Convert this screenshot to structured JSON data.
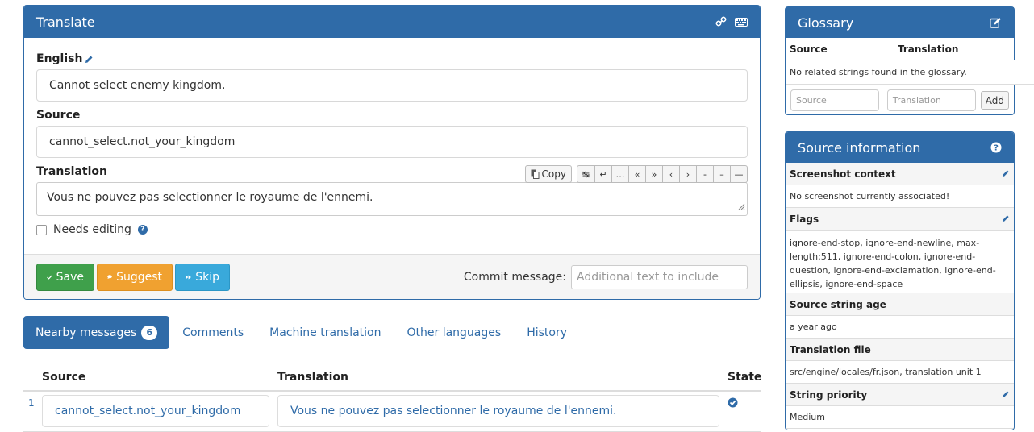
{
  "translate": {
    "title": "Translate",
    "english_label": "English",
    "english_text": "Cannot select enemy kingdom.",
    "source_label": "Source",
    "source_text": "cannot_select.not_your_kingdom",
    "translation_label": "Translation",
    "copy_label": "Copy",
    "tool_buttons": [
      "↹",
      "↵",
      "…",
      "«",
      "»",
      "‹",
      "›",
      "-",
      "–",
      "—"
    ],
    "translation_text": "Vous ne pouvez pas selectionner le royaume de l'ennemi.",
    "needs_editing_label": "Needs editing",
    "save_label": "Save",
    "suggest_label": "Suggest",
    "skip_label": "Skip",
    "commit_label": "Commit message:",
    "commit_placeholder": "Additional text to include"
  },
  "tabs": {
    "nearby": "Nearby messages",
    "nearby_count": "6",
    "comments": "Comments",
    "machine": "Machine translation",
    "other": "Other languages",
    "history": "History"
  },
  "nearby": {
    "col_source": "Source",
    "col_translation": "Translation",
    "col_state": "State",
    "rows": [
      {
        "num": "1",
        "source": "cannot_select.not_your_kingdom",
        "translation": "Vous ne pouvez pas selectionner le royaume de l'ennemi."
      }
    ]
  },
  "glossary": {
    "title": "Glossary",
    "col_source": "Source",
    "col_translation": "Translation",
    "empty_msg": "No related strings found in the glossary.",
    "source_placeholder": "Source",
    "translation_placeholder": "Translation",
    "add_label": "Add"
  },
  "source_info": {
    "title": "Source information",
    "screenshot_label": "Screenshot context",
    "screenshot_value": "No screenshot currently associated!",
    "flags_label": "Flags",
    "flags_value": "ignore-end-stop, ignore-end-newline, max-length:511, ignore-end-colon, ignore-end-question, ignore-end-exclamation, ignore-end-ellipsis, ignore-end-space",
    "age_label": "Source string age",
    "age_value": "a year ago",
    "file_label": "Translation file",
    "file_value": "src/engine/locales/fr.json, translation unit 1",
    "priority_label": "String priority",
    "priority_value": "Medium"
  },
  "colors": {
    "primary": "#2f6ba8",
    "save": "#3fa04b",
    "suggest": "#f0a130",
    "skip": "#39a9db"
  }
}
